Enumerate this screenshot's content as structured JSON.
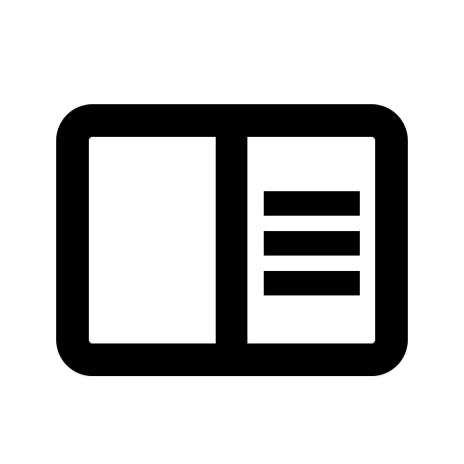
{
  "icon": {
    "name": "book-open-with-text-icon",
    "color": "#000000",
    "background": "#ffffff"
  }
}
